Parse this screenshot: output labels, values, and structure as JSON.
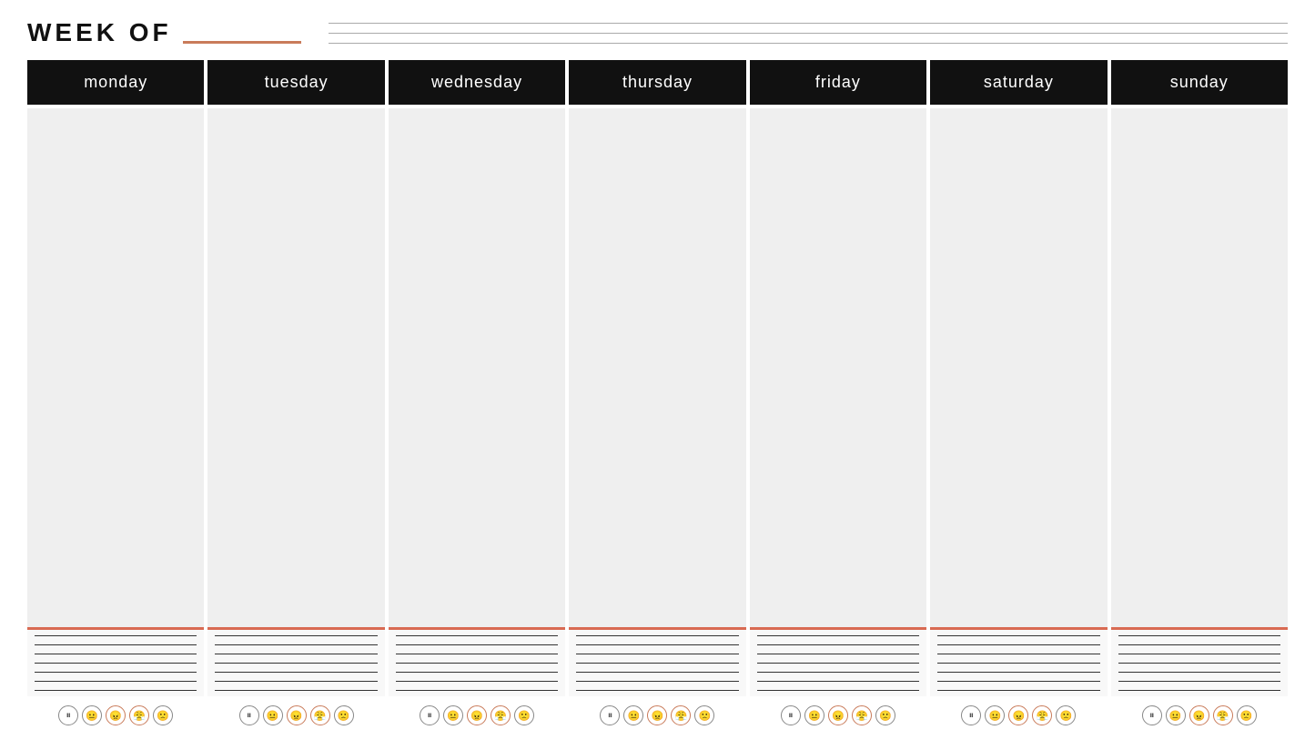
{
  "header": {
    "week_of_label": "WEEK OF",
    "underline_color": "#c97b5a",
    "header_lines_count": 3
  },
  "calendar": {
    "days": [
      {
        "id": "monday",
        "label": "monday"
      },
      {
        "id": "tuesday",
        "label": "tuesday"
      },
      {
        "id": "wednesday",
        "label": "wednesday"
      },
      {
        "id": "thursday",
        "label": "thursday"
      },
      {
        "id": "friday",
        "label": "friday"
      },
      {
        "id": "saturday",
        "label": "saturday"
      },
      {
        "id": "sunday",
        "label": "sunday"
      }
    ],
    "lines_per_day": 7,
    "mood_faces": [
      "😐",
      "🙂",
      "😠",
      "😤",
      "🙁"
    ],
    "accent_line_color": "#d96a52"
  }
}
